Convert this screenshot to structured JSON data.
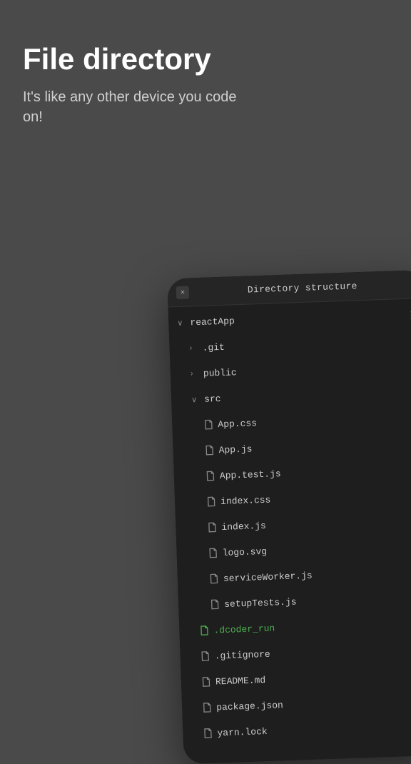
{
  "hero": {
    "title": "File directory",
    "subtitle": "It's like any other device you code on!"
  },
  "tab": {
    "close_label": "×",
    "title": "Directory structure"
  },
  "tree": {
    "items": [
      {
        "id": "reactApp",
        "indent": 0,
        "icon_type": "chevron-down",
        "label": "reactApp",
        "has_more": true,
        "is_file": false,
        "green": false
      },
      {
        "id": "git",
        "indent": 1,
        "icon_type": "chevron-right",
        "label": ".git",
        "has_more": true,
        "is_file": false,
        "green": false
      },
      {
        "id": "public",
        "indent": 1,
        "icon_type": "chevron-right",
        "label": "public",
        "has_more": true,
        "is_file": false,
        "green": false
      },
      {
        "id": "src",
        "indent": 1,
        "icon_type": "chevron-down",
        "label": "src",
        "has_more": true,
        "is_file": false,
        "green": false
      },
      {
        "id": "app_css",
        "indent": 2,
        "icon_type": "file",
        "label": "App.css",
        "has_more": true,
        "is_file": true,
        "green": false
      },
      {
        "id": "app_js",
        "indent": 2,
        "icon_type": "file",
        "label": "App.js",
        "has_more": true,
        "is_file": true,
        "green": false
      },
      {
        "id": "app_test",
        "indent": 2,
        "icon_type": "file",
        "label": "App.test.js",
        "has_more": true,
        "is_file": true,
        "green": false
      },
      {
        "id": "index_css",
        "indent": 2,
        "icon_type": "file",
        "label": "index.css",
        "has_more": true,
        "is_file": true,
        "green": false
      },
      {
        "id": "index_js",
        "indent": 2,
        "icon_type": "file",
        "label": "index.js",
        "has_more": true,
        "is_file": true,
        "green": false
      },
      {
        "id": "logo_svg",
        "indent": 2,
        "icon_type": "file",
        "label": "logo.svg",
        "has_more": true,
        "is_file": true,
        "green": false
      },
      {
        "id": "service_worker",
        "indent": 2,
        "icon_type": "file",
        "label": "serviceWorker.js",
        "has_more": true,
        "is_file": true,
        "green": false
      },
      {
        "id": "setup_tests",
        "indent": 2,
        "icon_type": "file",
        "label": "setupTests.js",
        "has_more": true,
        "is_file": true,
        "green": false
      },
      {
        "id": "dcoder_run",
        "indent": 1,
        "icon_type": "file",
        "label": ".dcoder_run",
        "has_more": false,
        "is_file": true,
        "green": true
      },
      {
        "id": "gitignore",
        "indent": 1,
        "icon_type": "file",
        "label": ".gitignore",
        "has_more": true,
        "is_file": true,
        "green": false
      },
      {
        "id": "readme",
        "indent": 1,
        "icon_type": "file",
        "label": "README.md",
        "has_more": true,
        "is_file": true,
        "green": false
      },
      {
        "id": "package_json",
        "indent": 1,
        "icon_type": "file",
        "label": "package.json",
        "has_more": true,
        "is_file": true,
        "green": false
      },
      {
        "id": "yarn_lock",
        "indent": 1,
        "icon_type": "file",
        "label": "yarn.lock",
        "has_more": true,
        "is_file": true,
        "green": false
      }
    ]
  }
}
